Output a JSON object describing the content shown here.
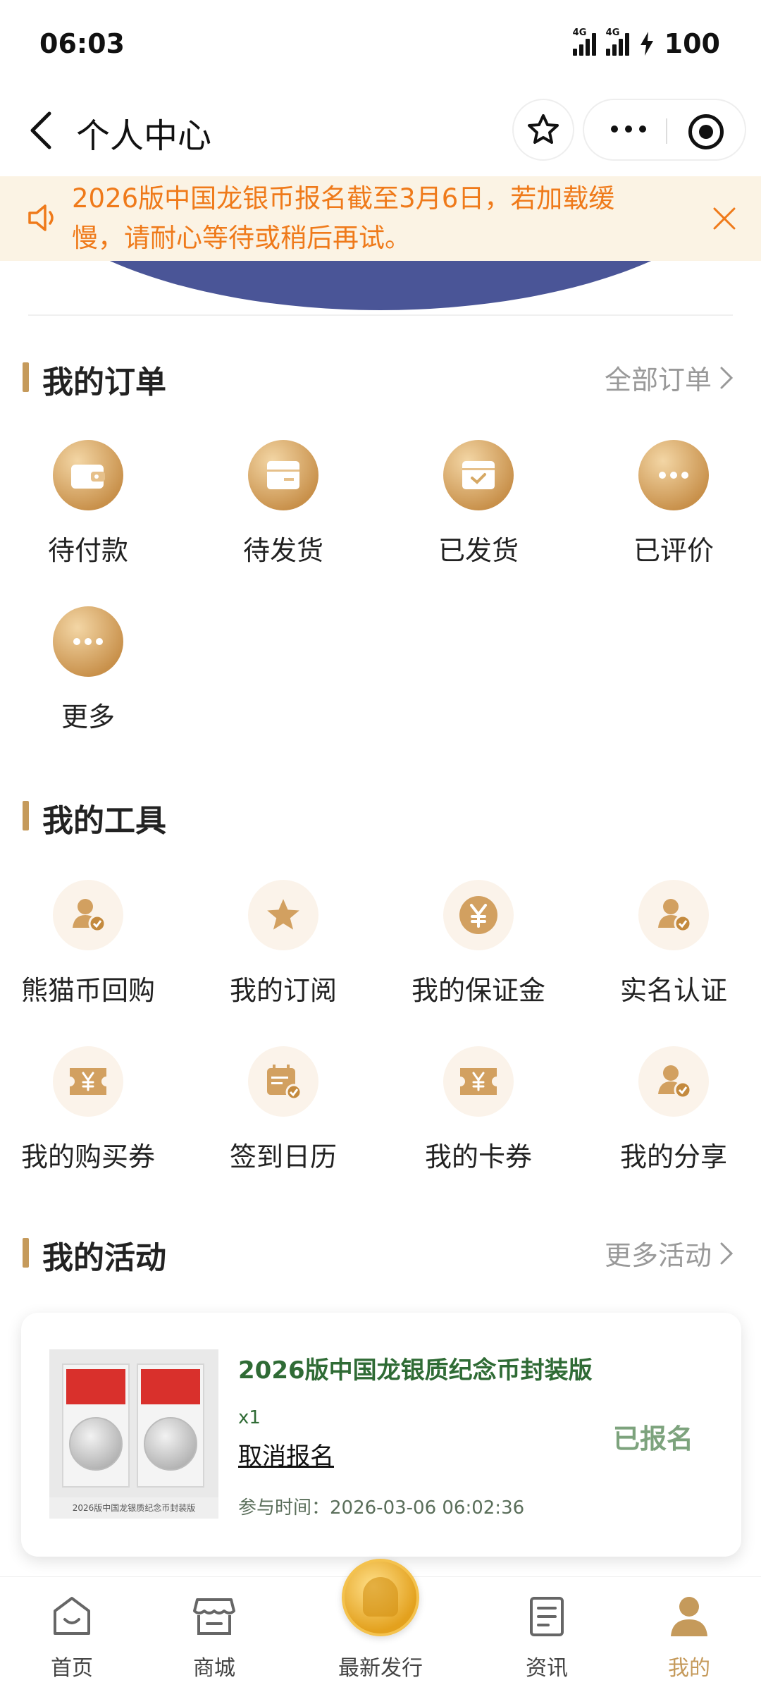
{
  "status_bar": {
    "time": "06:03",
    "network_1": "4G",
    "network_2": "4G",
    "battery": "100"
  },
  "nav": {
    "title": "个人中心"
  },
  "notice": {
    "text": "2026版中国龙银币报名截至3月6日，若加载缓慢，请耐心等待或稍后再试。"
  },
  "orders": {
    "title": "我的订单",
    "more": "全部订单",
    "items": [
      {
        "label": "待付款",
        "icon": "wallet-icon"
      },
      {
        "label": "待发货",
        "icon": "box-icon"
      },
      {
        "label": "已发货",
        "icon": "shipped-box-icon"
      },
      {
        "label": "已评价",
        "icon": "chat-dots-icon"
      },
      {
        "label": "更多",
        "icon": "more-dots-icon"
      }
    ]
  },
  "tools": {
    "title": "我的工具",
    "items": [
      {
        "label": "熊猫币回购",
        "icon": "user-check-icon"
      },
      {
        "label": "我的订阅",
        "icon": "star-icon"
      },
      {
        "label": "我的保证金",
        "icon": "yen-coin-icon"
      },
      {
        "label": "实名认证",
        "icon": "user-check-icon"
      },
      {
        "label": "我的购买券",
        "icon": "yen-ticket-icon"
      },
      {
        "label": "签到日历",
        "icon": "calendar-check-icon"
      },
      {
        "label": "我的卡券",
        "icon": "yen-ticket-icon"
      },
      {
        "label": "我的分享",
        "icon": "user-check-icon"
      }
    ]
  },
  "activities": {
    "title": "我的活动",
    "more": "更多活动",
    "card": {
      "title": "2026版中国龙银质纪念币封装版",
      "image_caption": "2026版中国龙银质纪念币封装版",
      "quantity": "x1",
      "cancel": "取消报名",
      "time_label": "参与时间：",
      "time_value": "2026-03-06 06:02:36",
      "status": "已报名"
    }
  },
  "tabbar": {
    "items": [
      {
        "label": "首页",
        "icon": "home-icon"
      },
      {
        "label": "商城",
        "icon": "shop-icon"
      },
      {
        "label": "最新发行",
        "icon": "gold-medal-icon"
      },
      {
        "label": "资讯",
        "icon": "news-icon"
      },
      {
        "label": "我的",
        "icon": "profile-icon"
      }
    ],
    "active": "我的",
    "active_color": "#c59a5b"
  },
  "colors": {
    "accent": "#c59a5b",
    "notice_text": "#ef7a1a",
    "notice_bg": "#fbf3e4",
    "activity_green": "#2f6b35"
  }
}
